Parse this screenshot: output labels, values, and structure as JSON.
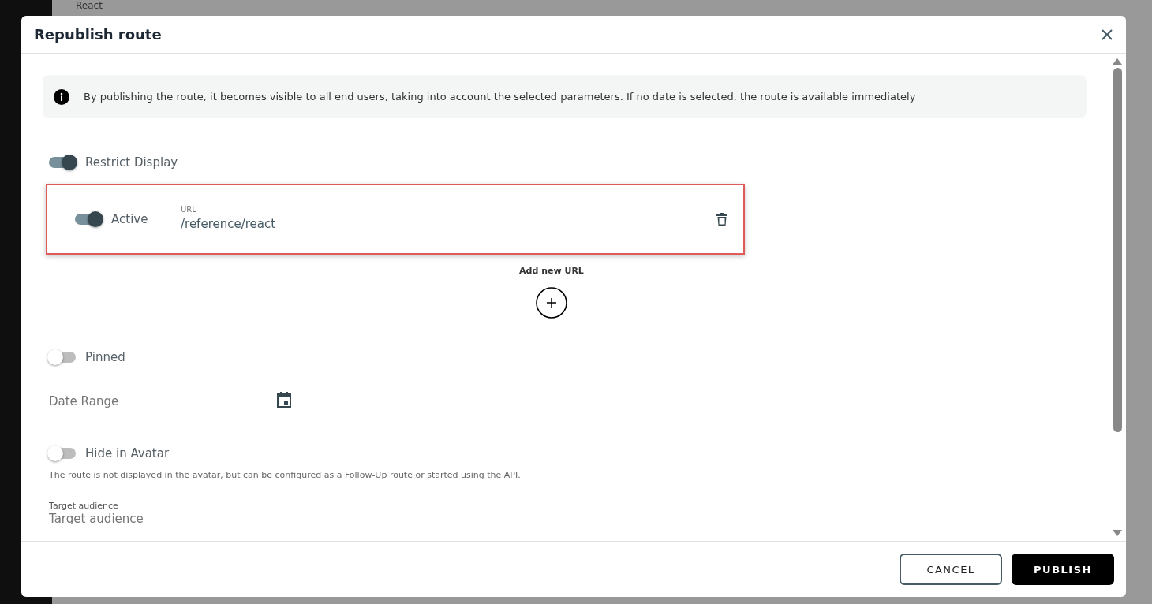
{
  "background": {
    "subtitle": "React"
  },
  "dialog": {
    "title": "Republish route",
    "info": "By publishing the route, it becomes visible to all end users, taking into account the selected parameters. If no date is selected, the route is available immediately",
    "restrict_display": {
      "label": "Restrict Display",
      "on": true
    },
    "urls": [
      {
        "label": "Active",
        "on": true,
        "field_label": "URL",
        "value": "/reference/react",
        "highlighted": true
      }
    ],
    "add_url": "Add new URL",
    "pinned": {
      "label": "Pinned",
      "on": false
    },
    "date_range": {
      "placeholder": "Date Range"
    },
    "hide_in_avatar": {
      "label": "Hide in Avatar",
      "on": false,
      "hint": "The route is not displayed in the avatar, but can be configured as a Follow-Up route or started using the API."
    },
    "target_audience": {
      "label": "Target audience",
      "placeholder": "Target audience"
    },
    "buttons": [
      {
        "label": "CANCEL",
        "kind": "outline"
      },
      {
        "label": "PUBLISH",
        "kind": "primary"
      }
    ]
  }
}
